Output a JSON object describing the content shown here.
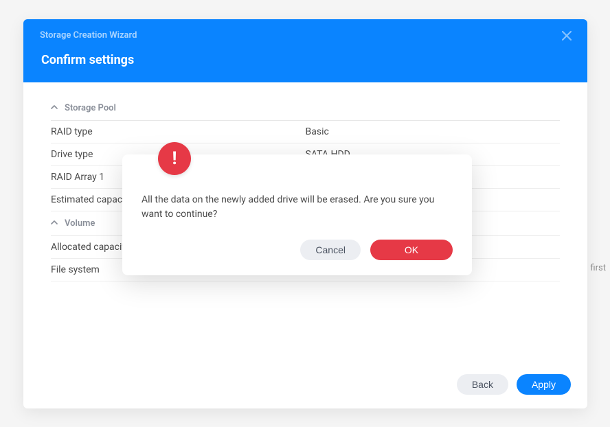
{
  "wizard": {
    "window_title": "Storage Creation Wizard",
    "step_title": "Confirm settings",
    "sections": {
      "storage_pool": {
        "header": "Storage Pool",
        "rows": {
          "raid_type": {
            "label": "RAID type",
            "value": "Basic"
          },
          "drive_type": {
            "label": "Drive type",
            "value": "SATA HDD"
          },
          "raid_array_1": {
            "label": "RAID Array 1",
            "value": ""
          },
          "estimated_capacity": {
            "label": "Estimated capacity",
            "value": ""
          }
        }
      },
      "volume": {
        "header": "Volume",
        "rows": {
          "allocated_capacity": {
            "label": "Allocated capacity",
            "value": ""
          },
          "file_system": {
            "label": "File system",
            "value": ""
          }
        }
      }
    },
    "footer": {
      "back_label": "Back",
      "apply_label": "Apply"
    }
  },
  "modal": {
    "message": "All the data on the newly added drive will be erased. Are you sure you want to continue?",
    "cancel_label": "Cancel",
    "ok_label": "OK"
  },
  "stray": {
    "text": "first"
  }
}
